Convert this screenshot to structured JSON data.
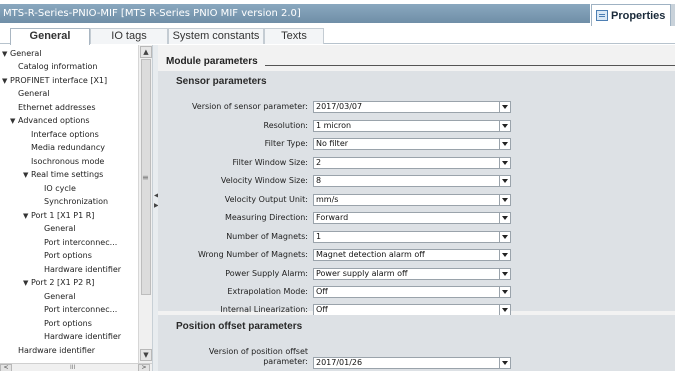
{
  "window": {
    "title": "MTS-R-Series-PNIO-MIF [MTS R-Series PNIO MIF version 2.0]",
    "properties_tab": "Properties"
  },
  "tabs": [
    {
      "label": "General",
      "active": true
    },
    {
      "label": "IO tags",
      "active": false
    },
    {
      "label": "System constants",
      "active": false
    },
    {
      "label": "Texts",
      "active": false
    }
  ],
  "nav": {
    "items": [
      {
        "label": "General",
        "expander": "▼"
      },
      {
        "label": "Catalog information",
        "expander": ""
      },
      {
        "label": "PROFINET interface [X1]",
        "expander": "▼"
      },
      {
        "label": "General",
        "expander": ""
      },
      {
        "label": "Ethernet addresses",
        "expander": ""
      },
      {
        "label": "Advanced options",
        "expander": "▼"
      },
      {
        "label": "Interface options",
        "expander": ""
      },
      {
        "label": "Media redundancy",
        "expander": ""
      },
      {
        "label": "Isochronous mode",
        "expander": ""
      },
      {
        "label": "Real time settings",
        "expander": "▼"
      },
      {
        "label": "IO cycle",
        "expander": ""
      },
      {
        "label": "Synchronization",
        "expander": ""
      },
      {
        "label": "Port 1 [X1 P1 R]",
        "expander": "▼"
      },
      {
        "label": "General",
        "expander": ""
      },
      {
        "label": "Port interconnec...",
        "expander": ""
      },
      {
        "label": "Port options",
        "expander": ""
      },
      {
        "label": "Hardware identifier",
        "expander": ""
      },
      {
        "label": "Port 2 [X1 P2 R]",
        "expander": "▼"
      },
      {
        "label": "General",
        "expander": ""
      },
      {
        "label": "Port interconnec...",
        "expander": ""
      },
      {
        "label": "Port options",
        "expander": ""
      },
      {
        "label": "Hardware identifier",
        "expander": ""
      },
      {
        "label": "Hardware identifier",
        "expander": ""
      }
    ],
    "scroll_up": "▲",
    "scroll_down": "▼",
    "scroll_left": "<",
    "scroll_right": ">",
    "grip": "≡",
    "hgrip": "III"
  },
  "module": {
    "heading": "Module parameters",
    "sensor_title": "Sensor parameters",
    "params": [
      {
        "label": "Version of sensor parameter:",
        "value": "2017/03/07"
      },
      {
        "label": "Resolution:",
        "value": "1 micron"
      },
      {
        "label": "Filter Type:",
        "value": "No filter"
      },
      {
        "label": "Filter Window Size:",
        "value": "2"
      },
      {
        "label": "Velocity Window Size:",
        "value": "8"
      },
      {
        "label": "Velocity Output Unit:",
        "value": "mm/s"
      },
      {
        "label": "Measuring Direction:",
        "value": "Forward"
      },
      {
        "label": "Number of Magnets:",
        "value": "1"
      },
      {
        "label": "Wrong Number of Magnets:",
        "value": "Magnet detection alarm off"
      },
      {
        "label": "Power Supply Alarm:",
        "value": "Power supply alarm off"
      },
      {
        "label": "Extrapolation Mode:",
        "value": "Off"
      },
      {
        "label": "Internal Linearization:",
        "value": "Off"
      }
    ],
    "offset_title": "Position offset parameters",
    "offset_version_label_1": "Version of position offset",
    "offset_version_label_2": "parameter:",
    "offset_version_value": "2017/01/26"
  }
}
